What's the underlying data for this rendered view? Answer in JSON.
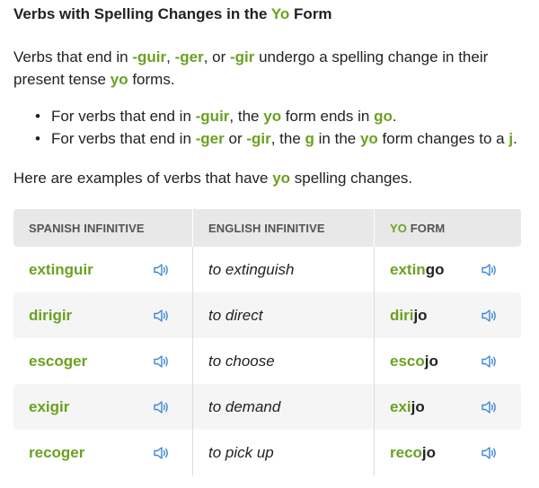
{
  "colors": {
    "accent_green": "#6aa121",
    "speaker_blue": "#3d86d8",
    "header_bg": "#e8e8e8",
    "alt_row_bg": "#f5f5f5"
  },
  "heading": {
    "pre": "Verbs with Spelling Changes in the ",
    "yo": "Yo",
    "post": " Form"
  },
  "intro": {
    "t1": "Verbs that end in ",
    "e1": "-guir",
    "t2": ", ",
    "e2": "-ger",
    "t3": ", or ",
    "e3": "-gir",
    "t4": " undergo a spelling change in their present tense ",
    "yo": "yo",
    "t5": " forms."
  },
  "rules": [
    {
      "t1": "For verbs that end in ",
      "e1": "-guir",
      "t2": ", the ",
      "yo": "yo",
      "t3": " form ends in ",
      "e2": "go",
      "t4": "."
    },
    {
      "t1": "For verbs that end in ",
      "e1": "-ger",
      "t2": " or ",
      "e2": "-gir",
      "t3": ", the ",
      "e3": "g",
      "t4": " in the ",
      "yo": "yo",
      "t5": " form changes to a ",
      "e4": "j",
      "t6": "."
    }
  ],
  "examples": {
    "t1": "Here are examples of verbs that have ",
    "yo": "yo",
    "t2": " spelling changes."
  },
  "table": {
    "headers": {
      "spanish": "SPANISH INFINITIVE",
      "english": "ENGLISH INFINITIVE",
      "yo_a": "YO",
      "yo_b": " FORM"
    },
    "rows": [
      {
        "spanish": "extinguir",
        "english": "to extinguish",
        "yo_stem": "extin",
        "yo_ending": "go"
      },
      {
        "spanish": "dirigir",
        "english": "to direct",
        "yo_stem": "diri",
        "yo_ending": "jo"
      },
      {
        "spanish": "escoger",
        "english": "to choose",
        "yo_stem": "esco",
        "yo_ending": "jo"
      },
      {
        "spanish": "exigir",
        "english": "to demand",
        "yo_stem": "exi",
        "yo_ending": "jo"
      },
      {
        "spanish": "recoger",
        "english": "to pick up",
        "yo_stem": "reco",
        "yo_ending": "jo"
      }
    ],
    "speaker_icon": "speaker-audio-icon"
  }
}
